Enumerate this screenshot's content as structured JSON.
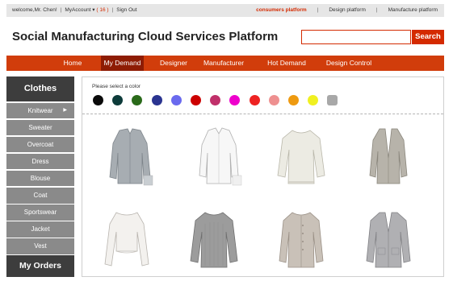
{
  "topbar": {
    "welcome": "welcome,Mr. Chen!",
    "account": "MyAccount",
    "account_count": "( 16 )",
    "sign_out": "Sign Out",
    "platforms": [
      "consumers platform",
      "Design platform",
      "Manufacture platform"
    ],
    "active_platform": "consumers platform"
  },
  "header": {
    "title": "Social Manufacturing Cloud Services Platform",
    "search_placeholder": "",
    "search_button": "Search"
  },
  "nav": {
    "items": [
      "Home",
      "My Demand",
      "Designer",
      "Manufacturer",
      "Hot Demand",
      "Design Control"
    ],
    "active": "My Demand"
  },
  "sidebar": {
    "heading": "Clothes",
    "items": [
      "Knitwear",
      "Sweater",
      "Overcoat",
      "Dress",
      "Blouse",
      "Coat",
      "Sportswear",
      "Jacket",
      "Vest"
    ],
    "footer": "My Orders"
  },
  "color_filter": {
    "label": "Please select a color",
    "colors": [
      "#0a0a0a",
      "#0d3b3a",
      "#2a6a1a",
      "#2a3490",
      "#6a6aee",
      "#cc0000",
      "#c0306a",
      "#ee00cc",
      "#ee2222",
      "#ee9090",
      "#ee9a10",
      "#f0f020",
      "#a8a8a8"
    ],
    "selected_index": 12
  },
  "products": [
    {
      "icon": "gray-shirt-icon",
      "color": "#a7adb2"
    },
    {
      "icon": "white-shirt-icon",
      "color": "#f4f4f4"
    },
    {
      "icon": "cream-sweater-icon",
      "color": "#ecebe3"
    },
    {
      "icon": "gray-cardigan-icon",
      "color": "#b7b3aa"
    },
    {
      "icon": "white-top-icon",
      "color": "#f3f1ee"
    },
    {
      "icon": "gray-knit-sweater-icon",
      "color": "#9c9c9c"
    },
    {
      "icon": "beige-cardigan-icon",
      "color": "#c9c1b8"
    },
    {
      "icon": "gray-cardigan-icon",
      "color": "#b0b0b3"
    }
  ]
}
